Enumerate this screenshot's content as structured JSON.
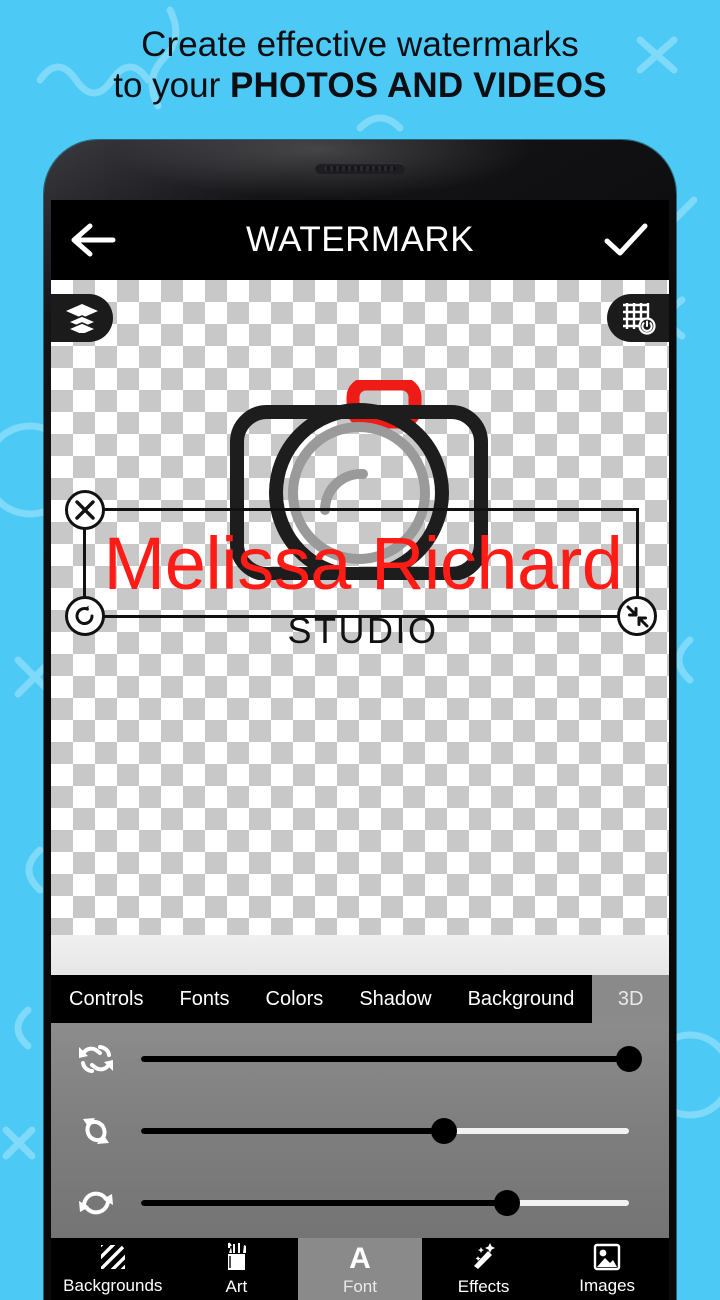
{
  "promo": {
    "line1": "Create effective watermarks",
    "line2_prefix": "to your ",
    "line2_bold": "PHOTOS AND VIDEOS",
    "background_color": "#4cc9f5",
    "text_color": "#0d0d12"
  },
  "appbar": {
    "back_icon": "arrow-left-icon",
    "title": "WATERMARK",
    "confirm_icon": "check-icon"
  },
  "canvas": {
    "layers_icon": "layers-icon",
    "grid_toggle_icon": "grid-power-icon",
    "artwork": "camera-outline-icon",
    "artwork_colors": {
      "body": "#1d1d1d",
      "flash": "#ee1b17",
      "lens": "#9a9a9a"
    },
    "watermark_text": "Melissa Richard",
    "watermark_color": "#ff1b16",
    "watermark_subtext": "STUDIO",
    "watermark_subtext_color": "#111111",
    "handles": {
      "close": "close-handle-icon",
      "rotate": "rotate-handle-icon",
      "resize": "resize-handle-icon"
    }
  },
  "tabs": [
    {
      "label": "Controls",
      "active": false
    },
    {
      "label": "Fonts",
      "active": false
    },
    {
      "label": "Colors",
      "active": false
    },
    {
      "label": "Shadow",
      "active": false
    },
    {
      "label": "Background",
      "active": false
    },
    {
      "label": "3D",
      "active": true
    }
  ],
  "sliders": [
    {
      "icon": "flip-horizontal-icon",
      "value": 100
    },
    {
      "icon": "flip-vertical-icon",
      "value": 62
    },
    {
      "icon": "rotate-z-icon",
      "value": 75
    }
  ],
  "bottom_nav": [
    {
      "label": "Backgrounds",
      "icon": "diagonal-stripes-icon",
      "active": false
    },
    {
      "label": "Art",
      "icon": "pencil-cup-icon",
      "active": false
    },
    {
      "label": "Font",
      "icon": "letter-a-icon",
      "active": true
    },
    {
      "label": "Effects",
      "icon": "magic-wand-icon",
      "active": false
    },
    {
      "label": "Images",
      "icon": "picture-icon",
      "active": false
    }
  ]
}
